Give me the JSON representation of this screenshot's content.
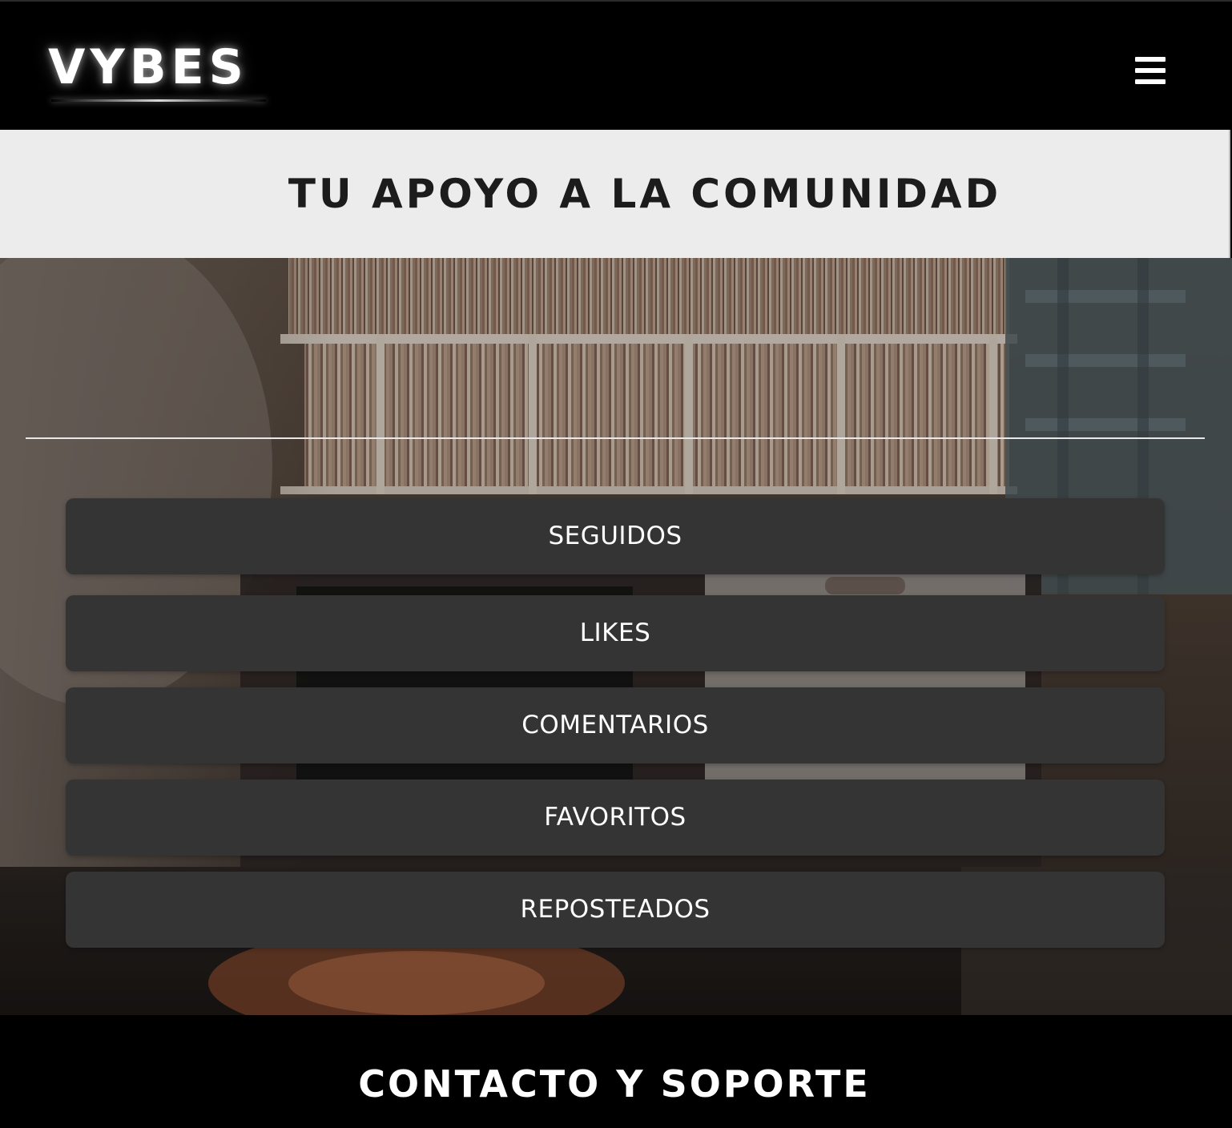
{
  "header": {
    "logo_text": "VYBES",
    "menu_icon": "hamburger-menu-icon"
  },
  "title_band": {
    "title": "TU APOYO A LA COMUNIDAD"
  },
  "hero": {
    "background_image": "record-store-shelves-photo"
  },
  "nav": {
    "items": [
      {
        "label": "SEGUIDOS"
      },
      {
        "label": "LIKES"
      },
      {
        "label": "COMENTARIOS"
      },
      {
        "label": "FAVORITOS"
      },
      {
        "label": "REPOSTEADOS"
      }
    ]
  },
  "footer": {
    "title": "CONTACTO Y SOPORTE"
  },
  "colors": {
    "header_bg": "#000000",
    "title_band_bg": "#ececec",
    "button_bg": "#343434",
    "button_text": "#ffffff",
    "title_text": "#1c1c1c"
  }
}
